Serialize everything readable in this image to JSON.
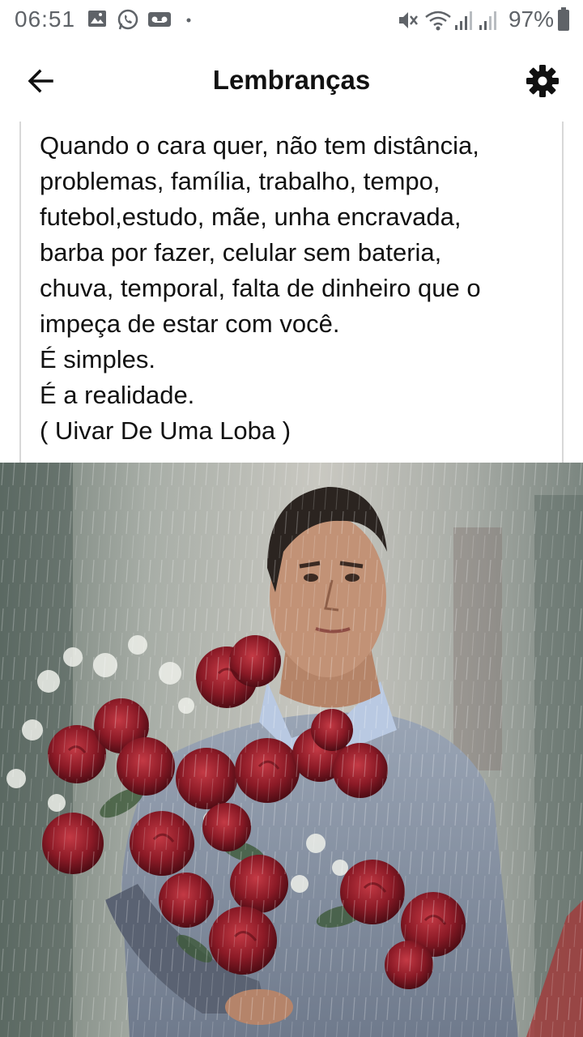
{
  "status_bar": {
    "time": "06:51",
    "battery": "97%",
    "icons": [
      "image-notification-icon",
      "whatsapp-icon",
      "voicemail-icon",
      "dot-icon",
      "mute-icon",
      "wifi-icon",
      "signal-icon",
      "signal-icon-2",
      "battery-icon"
    ]
  },
  "app_bar": {
    "title": "Lembranças",
    "back_icon": "arrow-back-icon",
    "settings_icon": "gear-icon"
  },
  "memory": {
    "text": "Quando o cara quer, não tem distância,\nproblemas, família, trabalho, tempo,\nfutebol,estudo, mãe, unha encravada,\nbarba por fazer, celular sem bateria,\nchuva, temporal, falta de dinheiro que o\nimpeça de estar com você.\nÉ simples.\nÉ a realidade.\n( Uivar De Uma Loba )"
  },
  "colors": {
    "status_text": "#5f6368",
    "title_text": "#111111",
    "card_border": "#d8d8d8",
    "rose": "#8b1a26",
    "sweater": "#8a96a8"
  }
}
